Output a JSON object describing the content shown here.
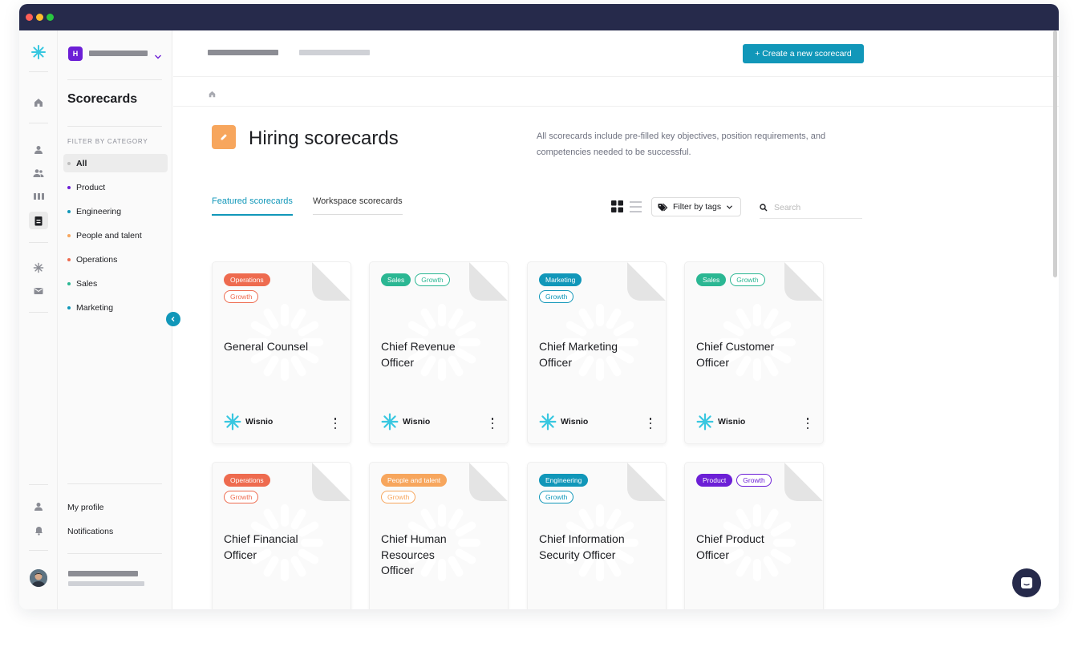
{
  "colors": {
    "titlebar": "#262a4b",
    "accent": "#1197b9",
    "orange": "#f7a65d",
    "window_dots": [
      "#ff5f57",
      "#febc2e",
      "#28c840"
    ]
  },
  "workspace": {
    "initial": "H"
  },
  "sidebar": {
    "title": "Scorecards",
    "filter_caption": "FILTER BY CATEGORY",
    "categories": [
      {
        "label": "All",
        "color": "#bdbdbd",
        "active": true
      },
      {
        "label": "Product",
        "color": "#6c1fd6"
      },
      {
        "label": "Engineering",
        "color": "#1197b9"
      },
      {
        "label": "People and talent",
        "color": "#f7a65d"
      },
      {
        "label": "Operations",
        "color": "#ee6b4f"
      },
      {
        "label": "Sales",
        "color": "#2bb793"
      },
      {
        "label": "Marketing",
        "color": "#1197b9"
      }
    ],
    "bottom": {
      "profile": "My profile",
      "notifications": "Notifications"
    }
  },
  "topbar": {
    "create_button": "+ Create a new scorecard"
  },
  "header": {
    "title": "Hiring scorecards",
    "description": "All scorecards include pre-filled key objectives, position requirements, and competencies needed to be successful."
  },
  "tabs": [
    {
      "label": "Featured scorecards",
      "active": true
    },
    {
      "label": "Workspace scorecards"
    }
  ],
  "toolbar": {
    "filter_label": "Filter by tags",
    "search_placeholder": "Search"
  },
  "tag_colors": {
    "Operations": "#ee6b4f",
    "Sales": "#2bb793",
    "Marketing": "#1197b9",
    "People and talent": "#f7a65d",
    "Engineering": "#1197b9",
    "Product": "#6c1fd6"
  },
  "cards": [
    {
      "category": "Operations",
      "growth": "Growth",
      "title": "General Counsel",
      "author": "Wisnio"
    },
    {
      "category": "Sales",
      "growth": "Growth",
      "title": "Chief Revenue Officer",
      "author": "Wisnio"
    },
    {
      "category": "Marketing",
      "growth": "Growth",
      "title": "Chief Marketing Officer",
      "author": "Wisnio"
    },
    {
      "category": "Sales",
      "growth": "Growth",
      "title": "Chief Customer Officer",
      "author": "Wisnio"
    },
    {
      "category": "Operations",
      "growth": "Growth",
      "title": "Chief Financial Officer"
    },
    {
      "category": "People and talent",
      "growth": "Growth",
      "title": "Chief Human Resources Officer"
    },
    {
      "category": "Engineering",
      "growth": "Growth",
      "title": "Chief Information Security Officer"
    },
    {
      "category": "Product",
      "growth": "Growth",
      "title": "Chief Product Officer"
    }
  ]
}
